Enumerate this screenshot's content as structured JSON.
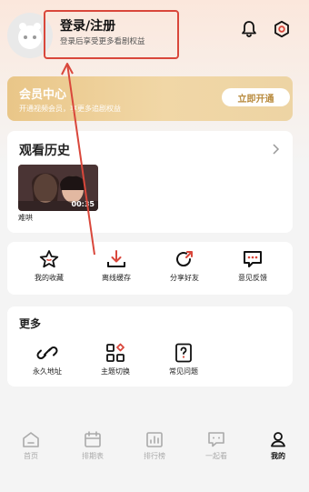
{
  "header": {
    "login_title": "登录/注册",
    "login_subtitle": "登录后享受更多看剧权益",
    "avatar_icon": "user-avatar-icon",
    "bell_icon": "bell-icon",
    "settings_icon": "settings-icon"
  },
  "member": {
    "title": "会员中心",
    "subtitle": "开通视频会员，享更多追剧权益",
    "button": "立即开通"
  },
  "history": {
    "title": "观看历史",
    "items": [
      {
        "name": "难哄",
        "duration": "00:35"
      }
    ]
  },
  "actions": [
    {
      "label": "我的收藏",
      "icon": "star-icon"
    },
    {
      "label": "离线缓存",
      "icon": "download-icon"
    },
    {
      "label": "分享好友",
      "icon": "share-icon"
    },
    {
      "label": "意见反馈",
      "icon": "feedback-icon"
    }
  ],
  "more": {
    "title": "更多",
    "items": [
      {
        "label": "永久地址",
        "icon": "link-icon"
      },
      {
        "label": "主题切换",
        "icon": "theme-icon"
      },
      {
        "label": "常见问题",
        "icon": "faq-icon"
      }
    ]
  },
  "tabbar": [
    {
      "label": "首页",
      "icon": "home-icon"
    },
    {
      "label": "排期表",
      "icon": "calendar-icon"
    },
    {
      "label": "排行榜",
      "icon": "ranking-icon"
    },
    {
      "label": "一起看",
      "icon": "watch-together-icon"
    },
    {
      "label": "我的",
      "icon": "profile-icon",
      "active": true
    }
  ],
  "colors": {
    "accent_red": "#d9473b",
    "gold": "#b88a3c"
  }
}
